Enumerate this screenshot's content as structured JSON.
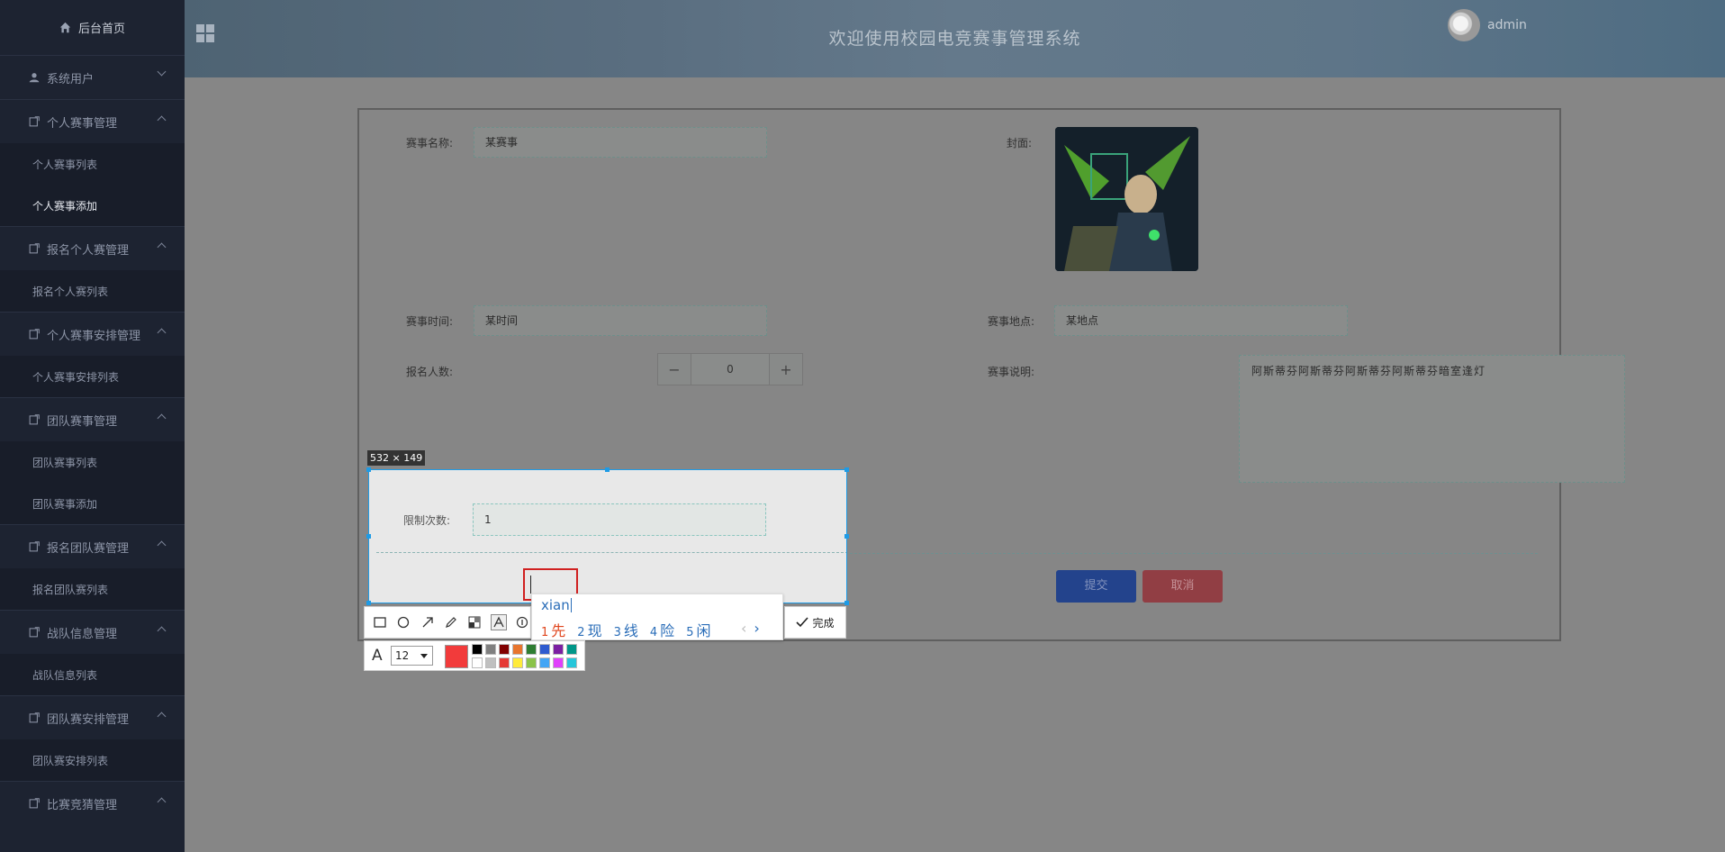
{
  "sidebar": {
    "home": "后台首页",
    "groups": [
      {
        "label": "系统用户",
        "items": []
      },
      {
        "label": "个人赛事管理",
        "items": [
          "个人赛事列表",
          "个人赛事添加"
        ]
      },
      {
        "label": "报名个人赛管理",
        "items": [
          "报名个人赛列表"
        ]
      },
      {
        "label": "个人赛事安排管理",
        "items": [
          "个人赛事安排列表"
        ]
      },
      {
        "label": "团队赛事管理",
        "items": [
          "团队赛事列表",
          "团队赛事添加"
        ]
      },
      {
        "label": "报名团队赛管理",
        "items": [
          "报名团队赛列表"
        ]
      },
      {
        "label": "战队信息管理",
        "items": [
          "战队信息列表"
        ]
      },
      {
        "label": "团队赛安排管理",
        "items": [
          "团队赛安排列表"
        ]
      },
      {
        "label": "比赛竞猜管理",
        "items": []
      }
    ],
    "active_item": "个人赛事添加"
  },
  "header": {
    "title": "欢迎使用校园电竞赛事管理系统",
    "username": "admin"
  },
  "form": {
    "name_label": "赛事名称:",
    "name_value": "某赛事",
    "cover_label": "封面:",
    "time_label": "赛事时间:",
    "time_value": "某时间",
    "location_label": "赛事地点:",
    "location_value": "某地点",
    "count_label": "报名人数:",
    "count_value": "0",
    "desc_label": "赛事说明:",
    "desc_value": "阿斯蒂芬阿斯蒂芬阿斯蒂芬阿斯蒂芬暗室逢灯",
    "limit_label": "限制次数:",
    "limit_value": "1",
    "submit_label": "提交",
    "cancel_label": "取消"
  },
  "capture": {
    "size_label": "532 × 149",
    "done_label": "完成",
    "font_size": "12",
    "current_color": "#f23b3b",
    "palette": [
      "#000000",
      "#808080",
      "#800000",
      "#e8752e",
      "#2e7d32",
      "#2e5bcf",
      "#7b1fa2",
      "#009688",
      "#ffffff",
      "#c0c0c0",
      "#e53935",
      "#ffeb3b",
      "#8bc34a",
      "#42a5f5",
      "#e040fb",
      "#26c6da"
    ],
    "tools": [
      "rect-icon",
      "ellipse-icon",
      "arrow-icon",
      "pencil-icon",
      "mosaic-icon",
      "text-icon",
      "number-icon"
    ]
  },
  "ime": {
    "pinyin": "xian",
    "candidates": [
      {
        "n": "1",
        "c": "先"
      },
      {
        "n": "2",
        "c": "现"
      },
      {
        "n": "3",
        "c": "线"
      },
      {
        "n": "4",
        "c": "险"
      },
      {
        "n": "5",
        "c": "闲"
      }
    ],
    "prev": "‹",
    "next": "›"
  }
}
